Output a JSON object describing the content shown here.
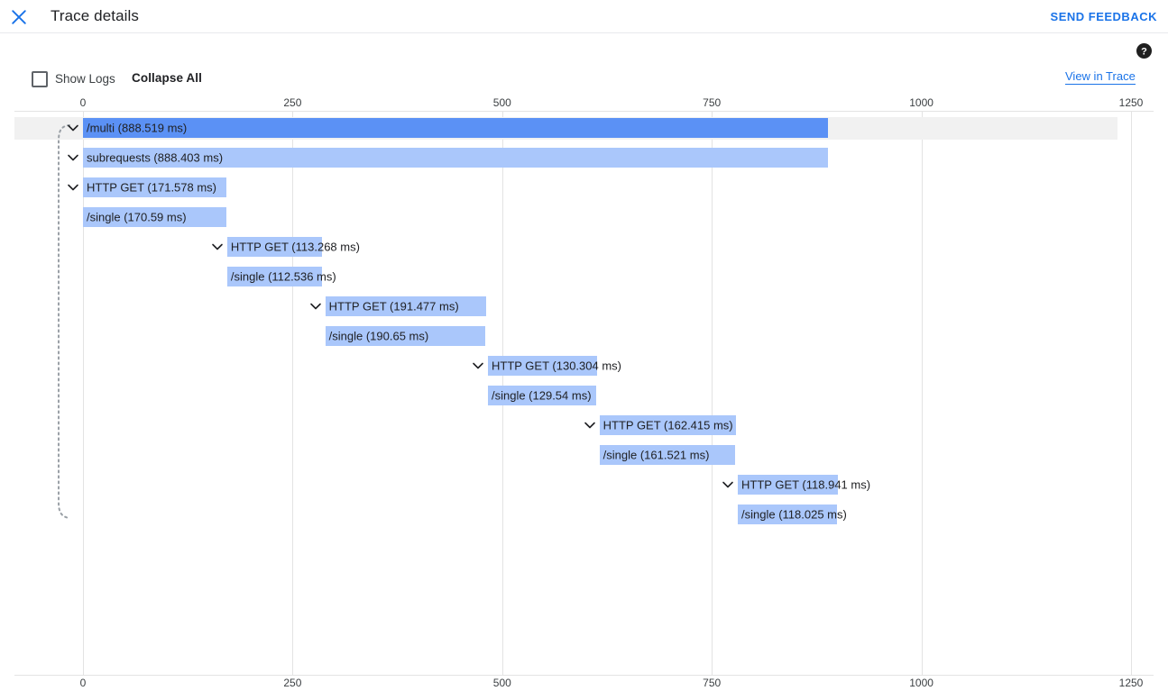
{
  "window": {
    "title": "Trace details",
    "close_icon": "close-icon",
    "send_feedback_label": "SEND FEEDBACK"
  },
  "toolbar": {
    "show_logs_label": "Show Logs",
    "show_logs_checked": false,
    "collapse_all_label": "Collapse All",
    "view_in_trace_label": "View in Trace",
    "help_icon": "help-circle-icon"
  },
  "colors": {
    "accent": "#1a73e8",
    "root_bar": "#5b91f5",
    "child_bar": "#aac7fb",
    "gridline": "#e3e3e3",
    "row_highlight": "#f1f1f1"
  },
  "chart_data": {
    "type": "bar",
    "title": "Trace details",
    "xlabel": "",
    "ylabel": "",
    "xlim": [
      0,
      1250
    ],
    "ticks": [
      0,
      250,
      500,
      750,
      1000,
      1250
    ],
    "tick_labels": [
      "0",
      "250",
      "500",
      "750",
      "1000",
      "1250"
    ],
    "grid": true,
    "unit": "ms",
    "axis_top_labels": [
      "0",
      "250",
      "500",
      "750",
      "1000",
      "1250"
    ],
    "axis_bottom_labels": [
      "0",
      "250",
      "500",
      "750",
      "1000",
      "1250"
    ],
    "spans": [
      {
        "label": "/multi (888.519 ms)",
        "name": "/multi",
        "duration_ms": 888.519,
        "start_ms": 0,
        "depth": 0,
        "root": true,
        "expandable": true,
        "selected": true
      },
      {
        "label": "subrequests (888.403 ms)",
        "name": "subrequests",
        "duration_ms": 888.403,
        "start_ms": 0,
        "depth": 1,
        "root": false,
        "expandable": true,
        "selected": false
      },
      {
        "label": "HTTP GET (171.578 ms)",
        "name": "HTTP GET",
        "duration_ms": 171.578,
        "start_ms": 0,
        "depth": 2,
        "root": false,
        "expandable": true,
        "selected": false
      },
      {
        "label": "/single (170.59 ms)",
        "name": "/single",
        "duration_ms": 170.59,
        "start_ms": 0,
        "depth": 3,
        "root": false,
        "expandable": false,
        "selected": false
      },
      {
        "label": "HTTP GET (113.268 ms)",
        "name": "HTTP GET",
        "duration_ms": 113.268,
        "start_ms": 172.0,
        "depth": 2,
        "root": false,
        "expandable": true,
        "selected": false
      },
      {
        "label": "/single (112.536 ms)",
        "name": "/single",
        "duration_ms": 112.536,
        "start_ms": 172.0,
        "depth": 3,
        "root": false,
        "expandable": false,
        "selected": false
      },
      {
        "label": "HTTP GET (191.477 ms)",
        "name": "HTTP GET",
        "duration_ms": 191.477,
        "start_ms": 289.0,
        "depth": 2,
        "root": false,
        "expandable": true,
        "selected": false
      },
      {
        "label": "/single (190.65 ms)",
        "name": "/single",
        "duration_ms": 190.65,
        "start_ms": 289.0,
        "depth": 3,
        "root": false,
        "expandable": false,
        "selected": false
      },
      {
        "label": "HTTP GET (130.304 ms)",
        "name": "HTTP GET",
        "duration_ms": 130.304,
        "start_ms": 483.0,
        "depth": 2,
        "root": false,
        "expandable": true,
        "selected": false
      },
      {
        "label": "/single (129.54 ms)",
        "name": "/single",
        "duration_ms": 129.54,
        "start_ms": 483.0,
        "depth": 3,
        "root": false,
        "expandable": false,
        "selected": false
      },
      {
        "label": "HTTP GET (162.415 ms)",
        "name": "HTTP GET",
        "duration_ms": 162.415,
        "start_ms": 616.0,
        "depth": 2,
        "root": false,
        "expandable": true,
        "selected": false
      },
      {
        "label": "/single (161.521 ms)",
        "name": "/single",
        "duration_ms": 161.521,
        "start_ms": 616.0,
        "depth": 3,
        "root": false,
        "expandable": false,
        "selected": false
      },
      {
        "label": "HTTP GET (118.941 ms)",
        "name": "HTTP GET",
        "duration_ms": 118.941,
        "start_ms": 781.0,
        "depth": 2,
        "root": false,
        "expandable": true,
        "selected": false
      },
      {
        "label": "/single (118.025 ms)",
        "name": "/single",
        "duration_ms": 118.025,
        "start_ms": 781.0,
        "depth": 3,
        "root": false,
        "expandable": false,
        "selected": false
      }
    ]
  }
}
